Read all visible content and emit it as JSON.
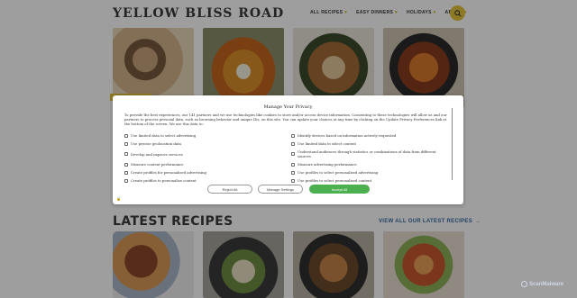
{
  "header": {
    "logo_text_1": "YELLOW",
    "logo_text_2": "BLISS ROAD",
    "nav": [
      {
        "label": "ALL RECIPES"
      },
      {
        "label": "EASY DINNERS"
      },
      {
        "label": "HOLIDAYS"
      },
      {
        "label": "ABOUT"
      }
    ],
    "search_icon": "search-icon"
  },
  "sections": {
    "latest_title": "LATEST RECIPES",
    "view_all": "VIEW ALL OUR LATEST RECIPES"
  },
  "privacy": {
    "title": "Manage Your Privacy",
    "body": "To provide the best experiences, our 141 partners and we use technologies like cookies to store and/or access device information. Consenting to these technologies will allow us and our partners to process personal data, such as browsing behavior and unique IDs, on this site. You can update your choices at any time by clicking on the Update Privacy Preferences link at the bottom of the screen. We use this data to:",
    "purposes": [
      "Use limited data to select advertising",
      "Identify devices based on information actively requested",
      "Use precise geolocation data",
      "Use limited data to select content",
      "Develop and improve services",
      "Understand audiences through statistics or combinations of data from different sources",
      "Measure content performance",
      "Measure advertising performance",
      "Create profiles for personalised advertising",
      "Use profiles to select personalised advertising",
      "Create profiles to personalise content",
      "Use profiles to select personalised content"
    ],
    "reject_label": "Reject All",
    "manage_label": "Manage Settings",
    "accept_label": "Accept All",
    "logo_text": "🔒"
  },
  "watermark": "ScanMalware",
  "colors": {
    "accent": "#e6c53c",
    "accept": "#4caf50",
    "link": "#3a6ea5"
  }
}
